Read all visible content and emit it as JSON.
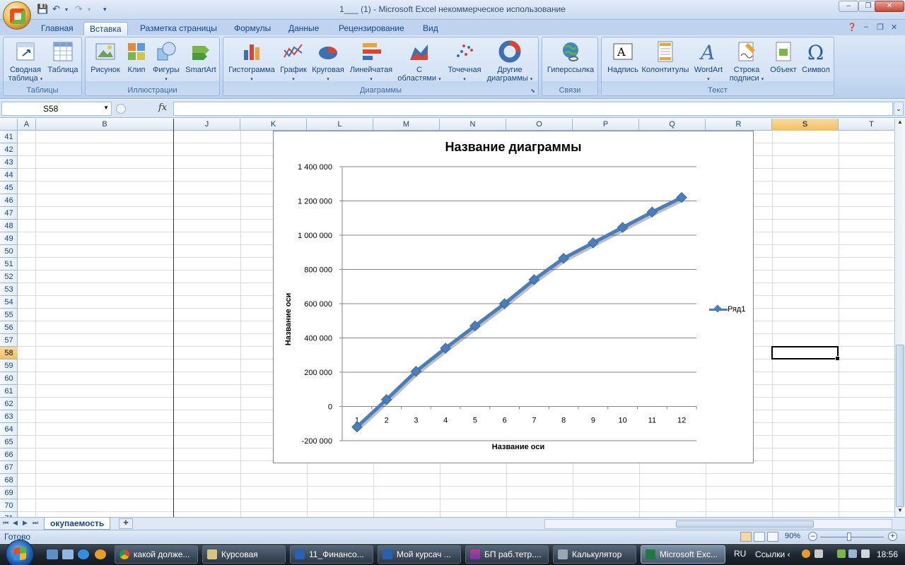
{
  "window": {
    "title": "1___ (1) - Microsoft Excel некоммерческое использование",
    "min_label": "‒",
    "restore_label": "❐",
    "close_label": "✕"
  },
  "ribbon_tabs": [
    "Главная",
    "Вставка",
    "Разметка страницы",
    "Формулы",
    "Данные",
    "Рецензирование",
    "Вид"
  ],
  "active_tab": "Вставка",
  "ribbon": {
    "groups": {
      "tables": "Таблицы",
      "illustrations": "Иллюстрации",
      "charts": "Диаграммы",
      "links": "Связи",
      "text": "Текст"
    },
    "buttons": {
      "pivot_line1": "Сводная",
      "pivot_line2": "таблица",
      "table": "Таблица",
      "picture": "Рисунок",
      "clip": "Клип",
      "shapes": "Фигуры",
      "smartart": "SmartArt",
      "histogram": "Гистограмма",
      "graph": "График",
      "pie": "Круговая",
      "bar": "Линейчатая",
      "area_line1": "С",
      "area_line2": "областями",
      "scatter": "Точечная",
      "other_line1": "Другие",
      "other_line2": "диаграммы",
      "hyperlink": "Гиперссылка",
      "textbox": "Надпись",
      "headers": "Колонтитулы",
      "wordart": "WordArt",
      "signature_line1": "Строка",
      "signature_line2": "подписи",
      "object": "Объект",
      "symbol": "Символ"
    }
  },
  "formula_bar": {
    "name_box": "S58",
    "fx": "fx",
    "value": ""
  },
  "columns": [
    "A",
    "B",
    "J",
    "K",
    "L",
    "M",
    "N",
    "O",
    "P",
    "Q",
    "R",
    "S",
    "T"
  ],
  "selected_column": "S",
  "rows": [
    "41",
    "42",
    "43",
    "44",
    "45",
    "46",
    "47",
    "48",
    "49",
    "50",
    "51",
    "52",
    "53",
    "54",
    "55",
    "56",
    "57",
    "58",
    "59",
    "60",
    "61",
    "62",
    "63",
    "64",
    "65",
    "66",
    "67",
    "68",
    "69",
    "70",
    "71"
  ],
  "selected_row": "58",
  "chart_data": {
    "type": "line",
    "title": "Название диаграммы",
    "xlabel": "Название оси",
    "ylabel": "Название оси",
    "categories": [
      "1",
      "2",
      "3",
      "4",
      "5",
      "6",
      "7",
      "8",
      "9",
      "10",
      "11",
      "12"
    ],
    "series": [
      {
        "name": "Ряд1",
        "values": [
          -120000,
          40000,
          205000,
          340000,
          470000,
          600000,
          740000,
          865000,
          955000,
          1045000,
          1135000,
          1220000
        ]
      }
    ],
    "ylim": [
      -200000,
      1400000
    ],
    "yticks": [
      -200000,
      0,
      200000,
      400000,
      600000,
      800000,
      1000000,
      1200000,
      1400000
    ],
    "ytick_labels": [
      "-200 000",
      "0",
      "200 000",
      "400 000",
      "600 000",
      "800 000",
      "1 000 000",
      "1 200 000",
      "1 400 000"
    ],
    "grid": true,
    "legend": "right",
    "color": "#4a7ebb"
  },
  "sheet_tabs": [
    "окупаемость"
  ],
  "status": {
    "text": "Готово",
    "zoom": "90%"
  },
  "taskbar": {
    "tasks": [
      "какой долже...",
      "Курсовая",
      "11_Финансо...",
      "Мой курсач ...",
      "БП раб.тетр....",
      "Калькулятор",
      "Microsoft Exc..."
    ],
    "active_task": "Microsoft Exc...",
    "lang": "RU",
    "links": "Ссылки",
    "time": "18:56"
  }
}
